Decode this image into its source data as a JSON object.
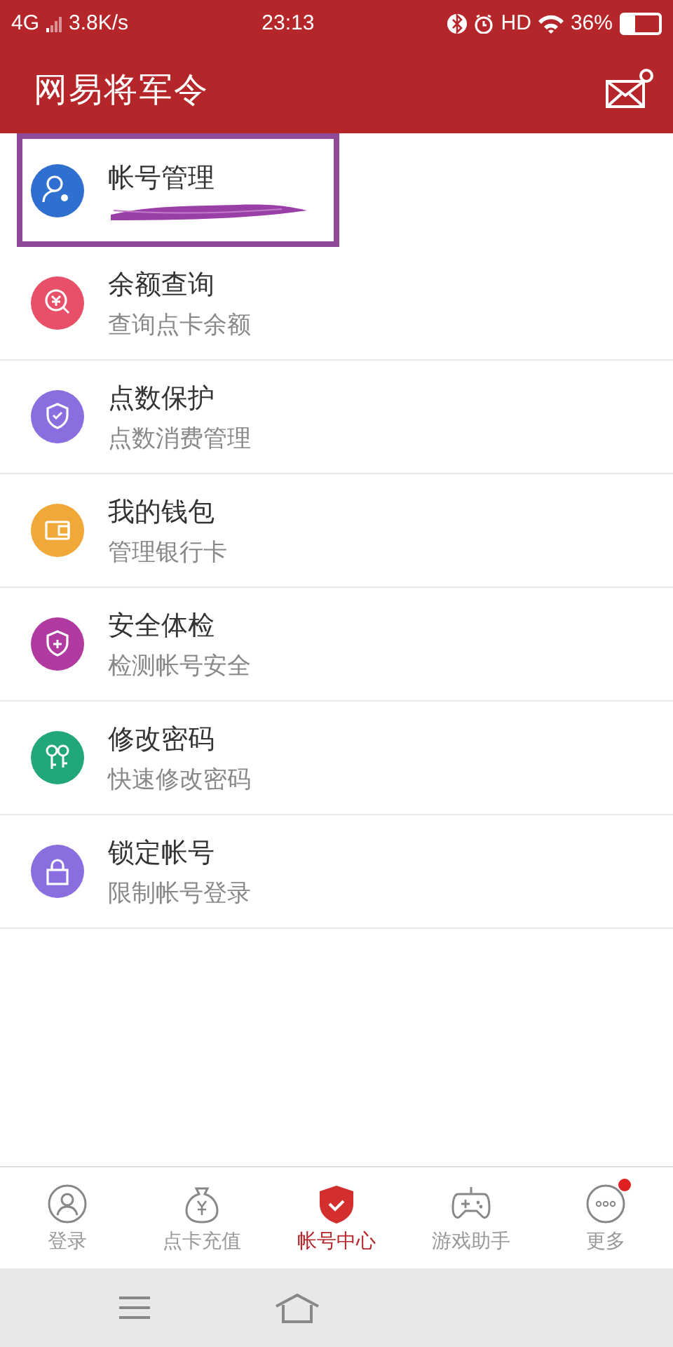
{
  "status_bar": {
    "network": "4G",
    "speed": "3.8K/s",
    "time": "23:13",
    "hd": "HD",
    "battery": "36%"
  },
  "header": {
    "title": "网易将军令"
  },
  "items": [
    {
      "kind": "user",
      "color": "#2f6fcf",
      "title": "帐号管理",
      "highlighted": true,
      "redacted": true
    },
    {
      "kind": "balance",
      "color": "#e8506a",
      "title": "余额查询",
      "subtitle": "查询点卡余额",
      "highlighted": false,
      "redacted": false
    },
    {
      "kind": "shield",
      "color": "#8a6ee0",
      "title": "点数保护",
      "subtitle": "点数消费管理",
      "highlighted": false,
      "redacted": false
    },
    {
      "kind": "wallet",
      "color": "#f0a838",
      "title": "我的钱包",
      "subtitle": "管理银行卡",
      "highlighted": false,
      "redacted": false
    },
    {
      "kind": "check",
      "color": "#b03aa0",
      "title": "安全体检",
      "subtitle": "检测帐号安全",
      "highlighted": false,
      "redacted": false
    },
    {
      "kind": "key",
      "color": "#22a878",
      "title": "修改密码",
      "subtitle": "快速修改密码",
      "highlighted": false,
      "redacted": false
    },
    {
      "kind": "lock",
      "color": "#8a6ee0",
      "title": "锁定帐号",
      "subtitle": "限制帐号登录",
      "highlighted": false,
      "redacted": false
    }
  ],
  "tabs": [
    {
      "kind": "login",
      "label": "登录",
      "selected": false,
      "dot": false
    },
    {
      "kind": "recharge",
      "label": "点卡充值",
      "selected": false,
      "dot": false
    },
    {
      "kind": "account",
      "label": "帐号中心",
      "selected": true,
      "dot": false
    },
    {
      "kind": "game",
      "label": "游戏助手",
      "selected": false,
      "dot": false
    },
    {
      "kind": "more",
      "label": "更多",
      "selected": false,
      "dot": true
    }
  ]
}
